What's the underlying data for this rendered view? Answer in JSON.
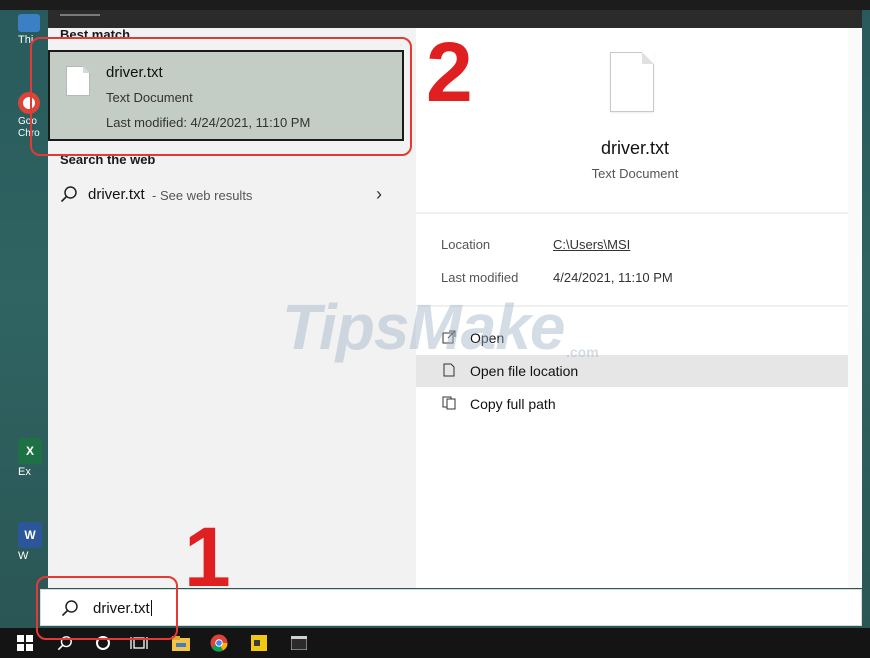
{
  "desktop": {
    "icons": [
      {
        "label": "Thi",
        "icon": "this-pc-icon"
      },
      {
        "label": "Goo Chro",
        "icon": "chrome-shortcut-icon"
      },
      {
        "label": "Ex",
        "icon": "excel-icon"
      },
      {
        "label": "W",
        "icon": "word-icon"
      }
    ]
  },
  "results": {
    "best_match_header": "Best match",
    "best_match": {
      "name": "driver.txt",
      "type": "Text Document",
      "modified": "Last modified: 4/24/2021, 11:10 PM"
    },
    "web_header": "Search the web",
    "web_result": {
      "term": "driver.txt",
      "hint": "- See web results"
    }
  },
  "preview": {
    "name": "driver.txt",
    "type": "Text Document",
    "location_label": "Location",
    "location_value": "C:\\Users\\MSI",
    "modified_label": "Last modified",
    "modified_value": "4/24/2021, 11:10 PM",
    "actions": [
      {
        "label": "Open",
        "icon": "open-icon"
      },
      {
        "label": "Open file location",
        "icon": "folder-location-icon"
      },
      {
        "label": "Copy full path",
        "icon": "copy-icon"
      }
    ]
  },
  "search": {
    "query": "driver.txt",
    "icon": "search-icon"
  },
  "annotations": {
    "step1": "1",
    "step2": "2",
    "color": "#e53935"
  },
  "watermark": {
    "text": "TipsMake",
    "suffix": ".com"
  },
  "taskbar": {
    "items": [
      "windows-start-icon",
      "search-icon",
      "cortana-icon",
      "task-view-icon",
      "file-explorer-icon",
      "chrome-icon",
      "sticky-notes-icon",
      "terminal-icon"
    ]
  }
}
